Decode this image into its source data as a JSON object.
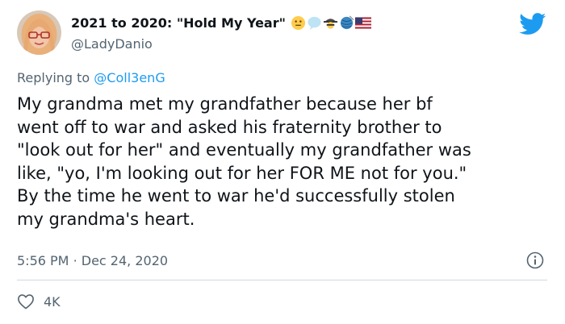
{
  "user": {
    "display_name": "2021 to 2020: \"Hold My Year\"",
    "handle": "@LadyDanio",
    "emojis": [
      "neutral-face-emoji",
      "speech-bubble-emoji",
      "detective-emoji",
      "yarn-emoji",
      "us-flag-emoji"
    ]
  },
  "reply": {
    "prefix": "Replying to",
    "mention": "@Coll3enG"
  },
  "tweet": {
    "lines": [
      "My grandma met my grandfather because her bf",
      "went off to war and asked his fraternity brother to",
      "\"look out for her\" and eventually my grandfather was",
      "like, \"yo, I'm looking out for her FOR ME not for you.\"",
      "By the time he went to war he'd successfully stolen",
      "my grandma's heart."
    ]
  },
  "meta": {
    "time": "5:56 PM",
    "separator": "·",
    "date": "Dec 24, 2020"
  },
  "stats": {
    "likes": "4K"
  },
  "icons": {
    "twitter_logo": "twitter-bird-icon",
    "info": "info-icon",
    "like": "heart-icon"
  },
  "colors": {
    "twitter_blue": "#1d9bf0",
    "secondary_text": "#536471",
    "divider": "#cfd9de"
  }
}
